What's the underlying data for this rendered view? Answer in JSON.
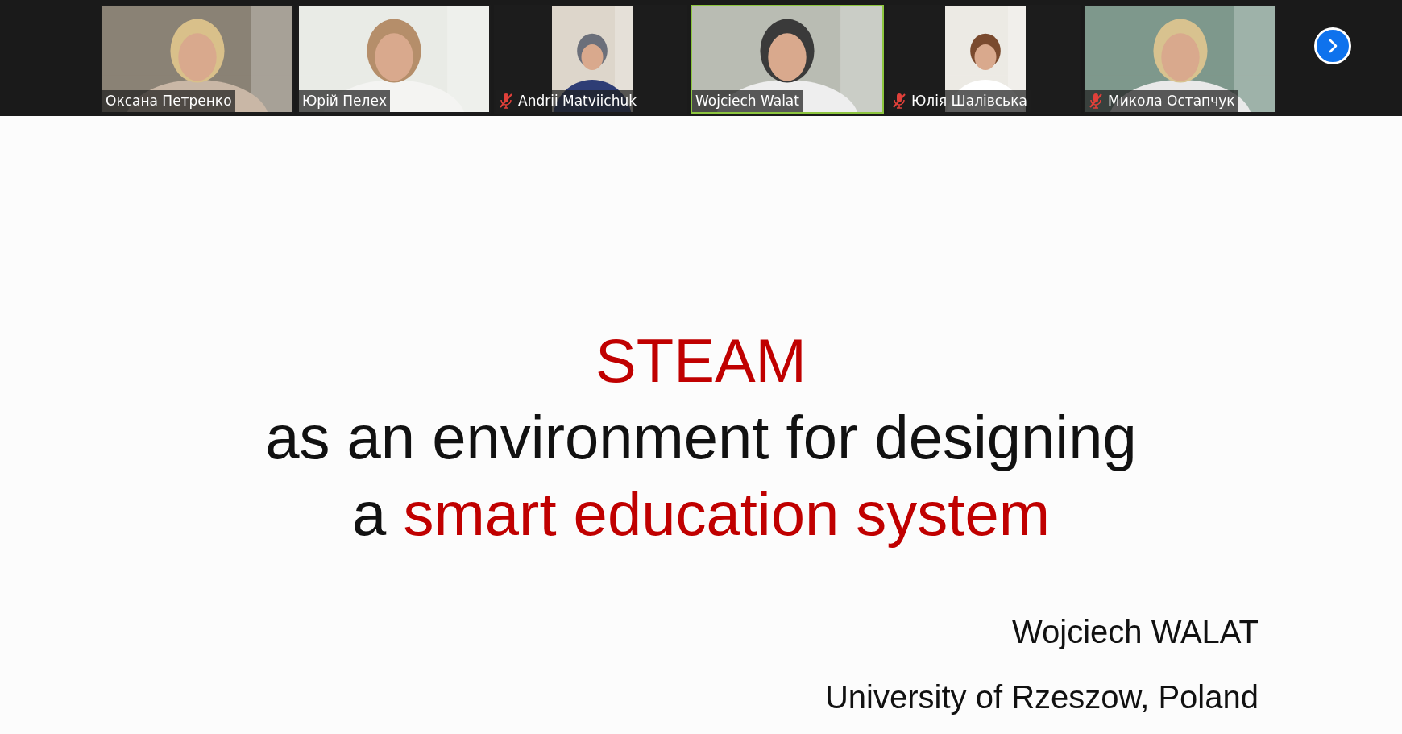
{
  "participants": [
    {
      "name": "Оксана Петренко",
      "muted": false,
      "active": false,
      "kind": "wide"
    },
    {
      "name": "Юрій Пелех",
      "muted": false,
      "active": false,
      "kind": "wide"
    },
    {
      "name": "Andrii Matviichuk",
      "muted": true,
      "active": false,
      "kind": "portrait"
    },
    {
      "name": "Wojciech Walat",
      "muted": false,
      "active": true,
      "kind": "wide"
    },
    {
      "name": "Юлія Шалівська",
      "muted": true,
      "active": false,
      "kind": "portrait"
    },
    {
      "name": "Микола Остапчук",
      "muted": true,
      "active": false,
      "kind": "wide"
    }
  ],
  "slide": {
    "title_lines": [
      [
        {
          "text": "STEAM",
          "accent": true
        }
      ],
      [
        {
          "text": "as an environment for designing",
          "accent": false
        }
      ],
      [
        {
          "text": "a",
          "accent": false
        },
        {
          "text": "smart education system",
          "accent": true
        }
      ]
    ],
    "author": "Wojciech WALAT",
    "affiliation": "University of Rzeszow, Poland"
  }
}
